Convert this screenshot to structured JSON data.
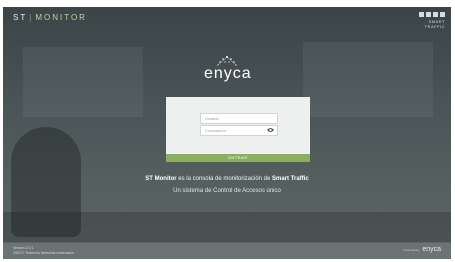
{
  "header": {
    "brand_left": "ST",
    "brand_sep": "|",
    "brand_right": "MONITOR",
    "partner_logo_text": "SMART TRAFFIC"
  },
  "login": {
    "logo_word": "enyca",
    "username_placeholder": "Usuario",
    "password_placeholder": "Contraseña",
    "submit_label": "ENTRAR"
  },
  "tagline": {
    "line1_prefix": "ST Monitor",
    "line1_middle": " es la consola de monitorización de ",
    "line1_suffix": "Smart Traffic",
    "line2": "Un sistema de Control de Accesos único"
  },
  "footer": {
    "version": "Versión 2.0.1",
    "copyright": "2023 © Todos los derechos reservados",
    "powered_by": "Powered by",
    "powered_logo": "enyca"
  },
  "colors": {
    "accent_green": "#8bb05d",
    "monitor_text": "#b8d6a3"
  }
}
